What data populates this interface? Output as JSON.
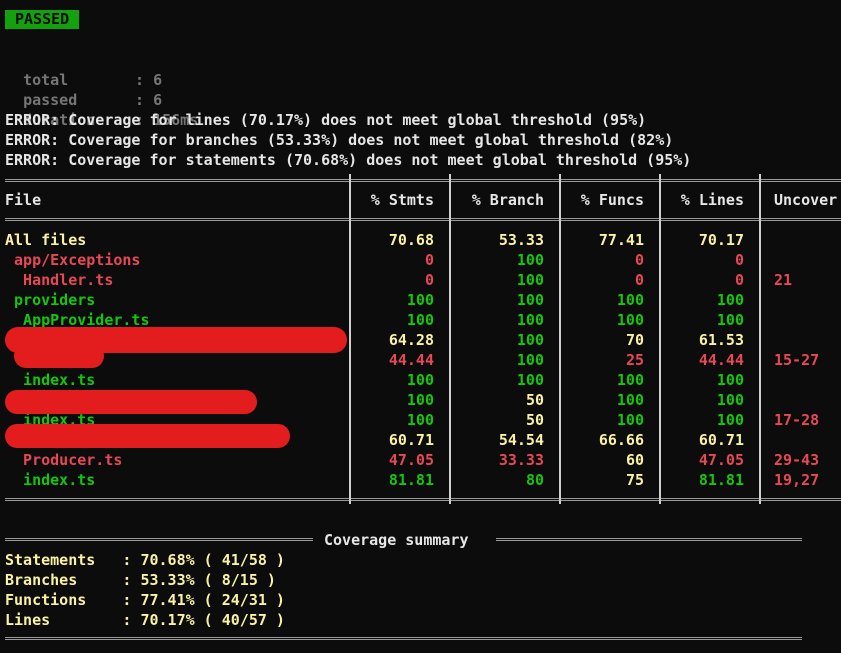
{
  "status_badge": "PASSED",
  "run": {
    "total_label": "total",
    "total_value": "6",
    "passed_label": "passed",
    "passed_value": "6",
    "duration_label": "duration",
    "duration_value": "156ms"
  },
  "errors": [
    "ERROR: Coverage for lines (70.17%) does not meet global threshold (95%)",
    "ERROR: Coverage for branches (53.33%) does not meet global threshold (82%)",
    "ERROR: Coverage for statements (70.68%) does not meet global threshold (95%)"
  ],
  "table": {
    "headers": [
      "File",
      "% Stmts",
      "% Branch",
      "% Funcs",
      "% Lines",
      "Uncover"
    ],
    "rows": [
      {
        "file": "All files",
        "stmts": "70.68",
        "branch": "53.33",
        "funcs": "77.41",
        "lines": "70.17",
        "uncovered": ""
      },
      {
        "file": " app/Exceptions",
        "stmts": "0",
        "branch": "100",
        "funcs": "0",
        "lines": "0",
        "uncovered": ""
      },
      {
        "file": "  Handler.ts",
        "stmts": "0",
        "branch": "100",
        "funcs": "0",
        "lines": "0",
        "uncovered": "21"
      },
      {
        "file": " providers",
        "stmts": "100",
        "branch": "100",
        "funcs": "100",
        "lines": "100",
        "uncovered": ""
      },
      {
        "file": "  AppProvider.ts",
        "stmts": "100",
        "branch": "100",
        "funcs": "100",
        "lines": "100",
        "uncovered": ""
      },
      {
        "file": "",
        "stmts": "64.28",
        "branch": "100",
        "funcs": "70",
        "lines": "61.53",
        "uncovered": ""
      },
      {
        "file": "",
        "stmts": "44.44",
        "branch": "100",
        "funcs": "25",
        "lines": "44.44",
        "uncovered": "15-27"
      },
      {
        "file": "  index.ts",
        "stmts": "100",
        "branch": "100",
        "funcs": "100",
        "lines": "100",
        "uncovered": ""
      },
      {
        "file": "",
        "stmts": "100",
        "branch": "50",
        "funcs": "100",
        "lines": "100",
        "uncovered": ""
      },
      {
        "file": "  index.ts",
        "stmts": "100",
        "branch": "50",
        "funcs": "100",
        "lines": "100",
        "uncovered": "17-28"
      },
      {
        "file": "",
        "stmts": "60.71",
        "branch": "54.54",
        "funcs": "66.66",
        "lines": "60.71",
        "uncovered": ""
      },
      {
        "file": "  Producer.ts",
        "stmts": "47.05",
        "branch": "33.33",
        "funcs": "60",
        "lines": "47.05",
        "uncovered": "29-43"
      },
      {
        "file": "  index.ts",
        "stmts": "81.81",
        "branch": "80",
        "funcs": "75",
        "lines": "81.81",
        "uncovered": "19,27"
      }
    ]
  },
  "summary": {
    "title": "Coverage summary",
    "statements": "Statements   : 70.68% ( 41/58 )",
    "branches": "Branches     : 53.33% ( 8/15 )",
    "functions": "Functions    : 77.41% ( 24/31 )",
    "lines": "Lines        : 70.17% ( 40/57 )"
  },
  "colors": {
    "yellow": "#f9f1a5",
    "red": "#e74856",
    "green": "#16c60c",
    "badge": "#13a10e",
    "redaction": "#e31d1d"
  }
}
